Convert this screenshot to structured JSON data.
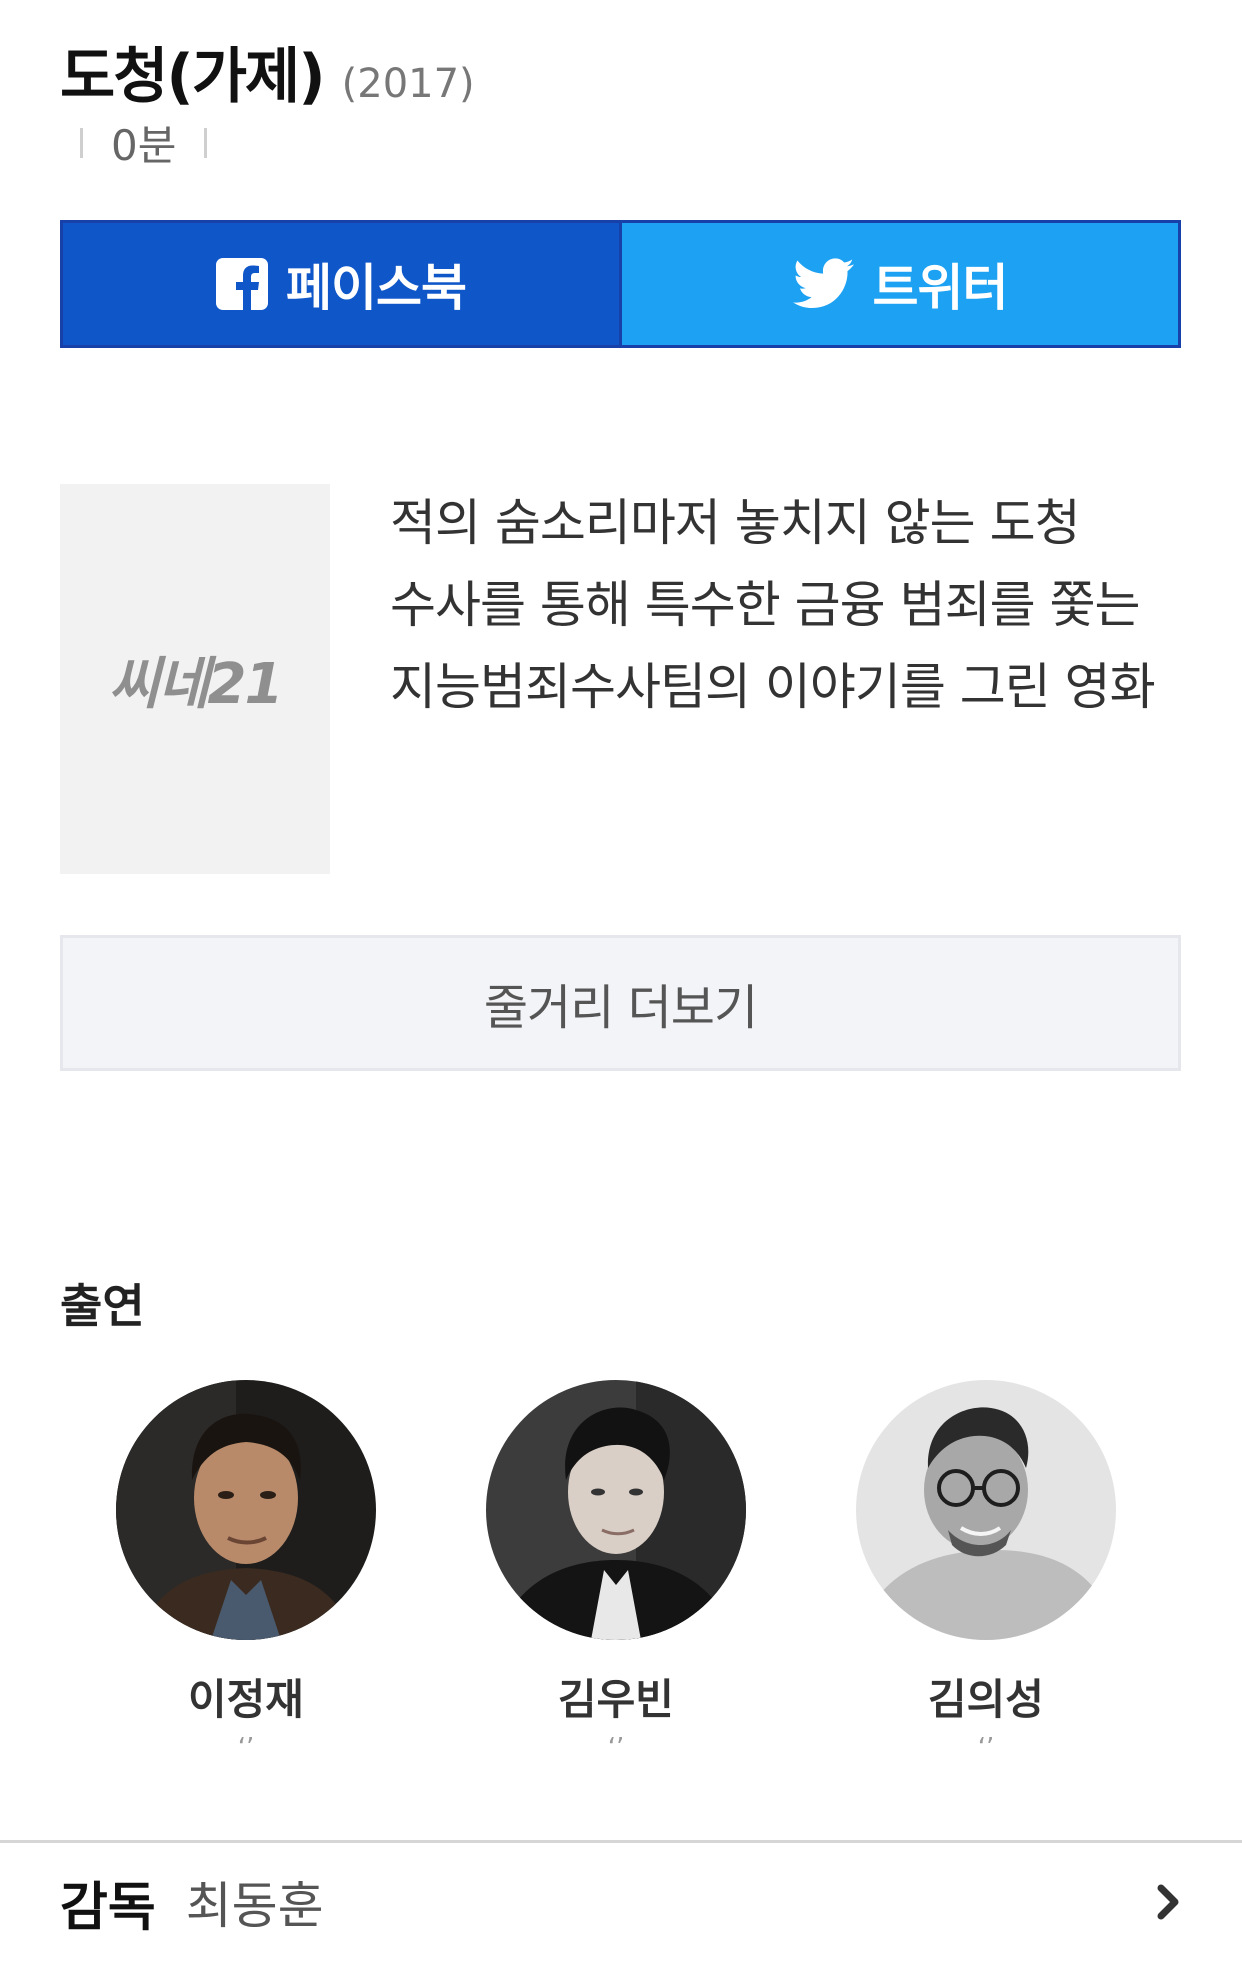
{
  "movie": {
    "title": "도청(가제)",
    "year": "(2017)",
    "runtime": "0분"
  },
  "share": {
    "facebook_label": "페이스북",
    "twitter_label": "트위터"
  },
  "poster": {
    "logo_text": "씨네21"
  },
  "synopsis": {
    "text": "적의 숨소리마저 놓치지 않는 도청 수사를 통해 특수한 금융 범죄를 쫓는 지능범죄수사팀의 이야기를 그린 영화"
  },
  "more_button": {
    "label": "줄거리 더보기"
  },
  "cast": {
    "heading": "출연",
    "members": [
      {
        "name": "이정재",
        "role": "‘’"
      },
      {
        "name": "김우빈",
        "role": "‘’"
      },
      {
        "name": "김의성",
        "role": "‘’"
      }
    ]
  },
  "director": {
    "label": "감독",
    "name": "최동훈"
  },
  "icons": {
    "facebook": "facebook-icon",
    "twitter": "twitter-icon",
    "chevron": "chevron-right-icon"
  },
  "colors": {
    "facebook_blue": "#0f56c8",
    "twitter_blue": "#1da1f2",
    "share_border": "#1740a8"
  }
}
